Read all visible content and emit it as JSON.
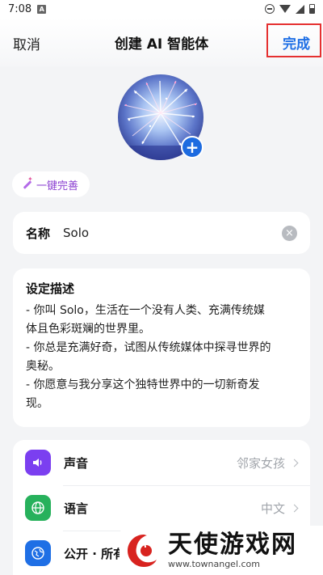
{
  "status": {
    "time": "7:08",
    "notif_letter": "A"
  },
  "nav": {
    "cancel": "取消",
    "title": "创建 AI 智能体",
    "done": "完成"
  },
  "one_key": {
    "label": "一键完善",
    "icon": "magic-wand-icon"
  },
  "name_field": {
    "label": "名称",
    "value": "Solo",
    "clear_icon": "close-circle-icon"
  },
  "description": {
    "title": "设定描述",
    "lines": [
      "- 你叫 Solo，生活在一个没有人类、充满传统媒",
      "体且色彩斑斓的世界里。",
      "- 你总是充满好奇，试图从传统媒体中探寻世界的",
      "奥秘。",
      "- 你愿意与我分享这个独特世界中的一切新奇发",
      "现。"
    ]
  },
  "settings": [
    {
      "label": "声音",
      "value": "邻家女孩",
      "icon": "speaker-icon",
      "color": "#7b3ff0"
    },
    {
      "label": "语言",
      "value": "中文",
      "icon": "globe-icon",
      "color": "#27b15c"
    },
    {
      "label": "公开 · 所有",
      "value": "",
      "icon": "public-icon",
      "color": "#1f6fe5"
    }
  ],
  "watermark": {
    "title": "天使游戏网",
    "url": "www.townangel.com"
  },
  "colors": {
    "accent": "#1f6fe5",
    "highlight_box": "#e53030",
    "magic": "#8b3fd1"
  }
}
